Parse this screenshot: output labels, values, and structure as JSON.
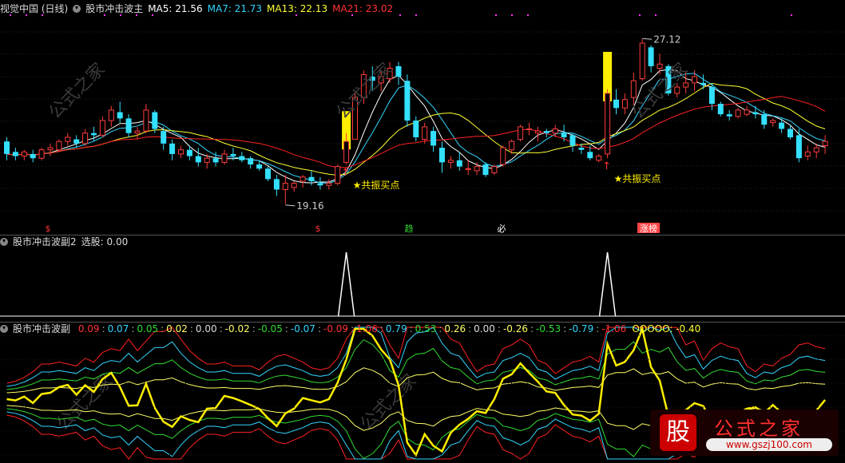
{
  "main_panel": {
    "title": "视觉中国 (日线)",
    "indicator_name": "股市冲击波主",
    "ma": [
      {
        "label": "MA5: 21.56",
        "color": "#ffffff"
      },
      {
        "label": "MA7: 21.73",
        "color": "#33d6ff"
      },
      {
        "label": "MA13: 22.13",
        "color": "#ffff33"
      },
      {
        "label": "MA21: 23.02",
        "color": "#ff3333"
      }
    ],
    "high_label": "27.12",
    "low_label": "19.16",
    "buy_signal_label": "★共振买点",
    "marker_labels": [
      "$",
      "$",
      "趋",
      "必",
      "涨榜"
    ]
  },
  "sub_panel_1": {
    "title": "股市冲击波副2",
    "value_label": "选股: 0.00"
  },
  "sub_panel_2": {
    "title": "股市冲击波副",
    "values": [
      {
        "text": "0.09",
        "color": "#ff3333"
      },
      {
        "text": "0.07",
        "color": "#33d6ff"
      },
      {
        "text": "0.05",
        "color": "#33dd33"
      },
      {
        "text": "0.02",
        "color": "#ffff66"
      },
      {
        "text": "0.00",
        "color": "#dddddd"
      },
      {
        "text": "-0.02",
        "color": "#ffff66"
      },
      {
        "text": "-0.05",
        "color": "#33dd33"
      },
      {
        "text": "-0.07",
        "color": "#33d6ff"
      },
      {
        "text": "-0.09",
        "color": "#ff3333"
      },
      {
        "text": "1.06",
        "color": "#ff3333"
      },
      {
        "text": "0.79",
        "color": "#33d6ff"
      },
      {
        "text": "0.53",
        "color": "#33dd33"
      },
      {
        "text": "0.26",
        "color": "#ffff66"
      },
      {
        "text": "0.00",
        "color": "#dddddd"
      },
      {
        "text": "-0.26",
        "color": "#ffff66"
      },
      {
        "text": "-0.53",
        "color": "#33dd33"
      },
      {
        "text": "-0.79",
        "color": "#33d6ff"
      },
      {
        "text": "-1.06",
        "color": "#ff3333"
      }
    ],
    "osc_label": "OOOOO: -0.40"
  },
  "logo": {
    "char": "股",
    "name": "公式之家",
    "url": "www.gszj100.com"
  },
  "chart_data": {
    "type": "candlestick",
    "candles": [
      [
        22.2,
        22.4,
        21.3,
        21.6
      ],
      [
        21.7,
        21.9,
        21.3,
        21.5
      ],
      [
        21.5,
        21.8,
        21.3,
        21.7
      ],
      [
        21.6,
        21.8,
        21.2,
        21.4
      ],
      [
        21.4,
        21.9,
        21.3,
        21.8
      ],
      [
        21.8,
        22.1,
        21.5,
        21.9
      ],
      [
        21.8,
        22.3,
        21.7,
        22.2
      ],
      [
        22.2,
        22.6,
        22.0,
        22.4
      ],
      [
        22.3,
        22.5,
        21.9,
        22.1
      ],
      [
        22.1,
        22.8,
        22.0,
        22.6
      ],
      [
        22.6,
        22.9,
        22.2,
        22.5
      ],
      [
        22.5,
        23.4,
        22.4,
        23.2
      ],
      [
        23.2,
        23.9,
        22.9,
        23.7
      ],
      [
        23.6,
        24.1,
        23.1,
        23.3
      ],
      [
        23.3,
        23.5,
        22.4,
        22.6
      ],
      [
        22.6,
        22.9,
        22.3,
        22.7
      ],
      [
        22.7,
        24.0,
        22.6,
        23.7
      ],
      [
        23.6,
        23.7,
        22.6,
        22.8
      ],
      [
        22.7,
        22.9,
        21.8,
        22.1
      ],
      [
        22.1,
        22.3,
        21.3,
        21.6
      ],
      [
        21.6,
        22.0,
        21.4,
        21.8
      ],
      [
        21.8,
        22.0,
        21.3,
        21.5
      ],
      [
        21.5,
        21.9,
        21.0,
        21.2
      ],
      [
        21.2,
        21.6,
        20.9,
        21.4
      ],
      [
        21.4,
        21.7,
        21.0,
        21.2
      ],
      [
        21.2,
        21.8,
        21.1,
        21.6
      ],
      [
        21.6,
        21.9,
        21.3,
        21.5
      ],
      [
        21.5,
        21.7,
        21.2,
        21.3
      ],
      [
        21.4,
        21.5,
        20.9,
        21.1
      ],
      [
        21.1,
        21.3,
        20.8,
        20.9
      ],
      [
        20.9,
        21.0,
        20.3,
        20.4
      ],
      [
        20.4,
        20.6,
        19.6,
        19.9
      ],
      [
        19.9,
        20.6,
        19.2,
        20.2
      ],
      [
        20.0,
        20.3,
        19.8,
        20.2
      ],
      [
        20.3,
        20.6,
        20.0,
        20.5
      ],
      [
        20.5,
        20.8,
        20.1,
        20.3
      ],
      [
        20.2,
        20.5,
        19.9,
        20.1
      ],
      [
        20.1,
        20.4,
        19.9,
        20.2
      ],
      [
        20.2,
        21.1,
        20.1,
        21.0
      ],
      [
        21.2,
        22.6,
        21.1,
        22.2
      ],
      [
        22.3,
        24.6,
        22.3,
        24.3
      ],
      [
        24.3,
        25.6,
        24.0,
        25.4
      ],
      [
        25.3,
        25.8,
        24.6,
        25.1
      ],
      [
        25.0,
        25.6,
        24.6,
        25.3
      ],
      [
        25.2,
        26.0,
        25.0,
        25.7
      ],
      [
        25.8,
        26.0,
        24.9,
        25.3
      ],
      [
        25.1,
        25.4,
        22.9,
        23.2
      ],
      [
        23.2,
        23.4,
        22.2,
        22.4
      ],
      [
        22.3,
        23.1,
        22.1,
        22.9
      ],
      [
        22.7,
        22.9,
        21.7,
        22.0
      ],
      [
        21.9,
        22.2,
        20.7,
        21.2
      ],
      [
        21.2,
        21.5,
        20.9,
        21.3
      ],
      [
        21.3,
        21.7,
        20.8,
        21.0
      ],
      [
        20.9,
        21.3,
        20.6,
        20.9
      ],
      [
        20.8,
        21.2,
        20.6,
        21.0
      ],
      [
        21.1,
        21.2,
        20.5,
        20.6
      ],
      [
        20.7,
        21.1,
        20.6,
        21.0
      ],
      [
        21.1,
        22.0,
        21.0,
        21.9
      ],
      [
        21.8,
        22.3,
        21.6,
        22.2
      ],
      [
        22.3,
        23.0,
        22.2,
        22.9
      ],
      [
        22.8,
        23.1,
        22.5,
        22.8
      ],
      [
        22.6,
        22.9,
        22.2,
        22.7
      ],
      [
        22.7,
        22.8,
        22.4,
        22.6
      ],
      [
        22.6,
        23.0,
        22.4,
        22.8
      ],
      [
        22.6,
        23.0,
        22.2,
        22.4
      ],
      [
        22.5,
        22.6,
        21.7,
        22.0
      ],
      [
        21.9,
        22.1,
        21.6,
        21.8
      ],
      [
        21.7,
        22.0,
        21.3,
        21.4
      ],
      [
        21.3,
        21.6,
        21.2,
        21.5
      ],
      [
        21.6,
        24.7,
        21.4,
        24.5
      ],
      [
        24.2,
        24.7,
        23.5,
        23.8
      ],
      [
        23.8,
        24.5,
        23.5,
        24.2
      ],
      [
        24.3,
        25.5,
        23.9,
        25.1
      ],
      [
        25.2,
        27.1,
        25.1,
        26.9
      ],
      [
        26.7,
        26.8,
        25.5,
        25.8
      ],
      [
        25.7,
        26.4,
        25.4,
        25.9
      ],
      [
        25.8,
        25.9,
        24.4,
        24.5
      ],
      [
        24.5,
        25.0,
        24.3,
        24.8
      ],
      [
        24.8,
        25.5,
        24.5,
        25.0
      ],
      [
        25.0,
        25.6,
        24.6,
        25.3
      ],
      [
        25.0,
        25.4,
        24.7,
        24.9
      ],
      [
        24.8,
        25.0,
        23.7,
        24.0
      ],
      [
        24.0,
        24.1,
        23.4,
        23.5
      ],
      [
        23.5,
        23.7,
        23.2,
        23.4
      ],
      [
        23.4,
        23.8,
        23.3,
        23.7
      ],
      [
        23.5,
        23.9,
        23.4,
        23.7
      ],
      [
        23.6,
        23.9,
        23.3,
        23.5
      ],
      [
        23.5,
        23.7,
        22.8,
        23.0
      ],
      [
        23.1,
        23.3,
        22.9,
        23.2
      ],
      [
        23.1,
        23.3,
        22.6,
        22.8
      ],
      [
        22.8,
        23.0,
        22.3,
        22.4
      ],
      [
        22.5,
        22.8,
        21.2,
        21.4
      ],
      [
        21.5,
        22.0,
        21.3,
        21.7
      ],
      [
        21.7,
        22.1,
        21.4,
        21.9
      ],
      [
        22.0,
        22.5,
        21.6,
        22.2
      ]
    ],
    "resonance_buy_indices": [
      39,
      69
    ],
    "stock_pick_spike_indices": [
      39,
      69
    ],
    "high_annotation": {
      "index": 73,
      "value": 27.12
    },
    "low_annotation": {
      "index": 32,
      "value": 19.16
    }
  }
}
